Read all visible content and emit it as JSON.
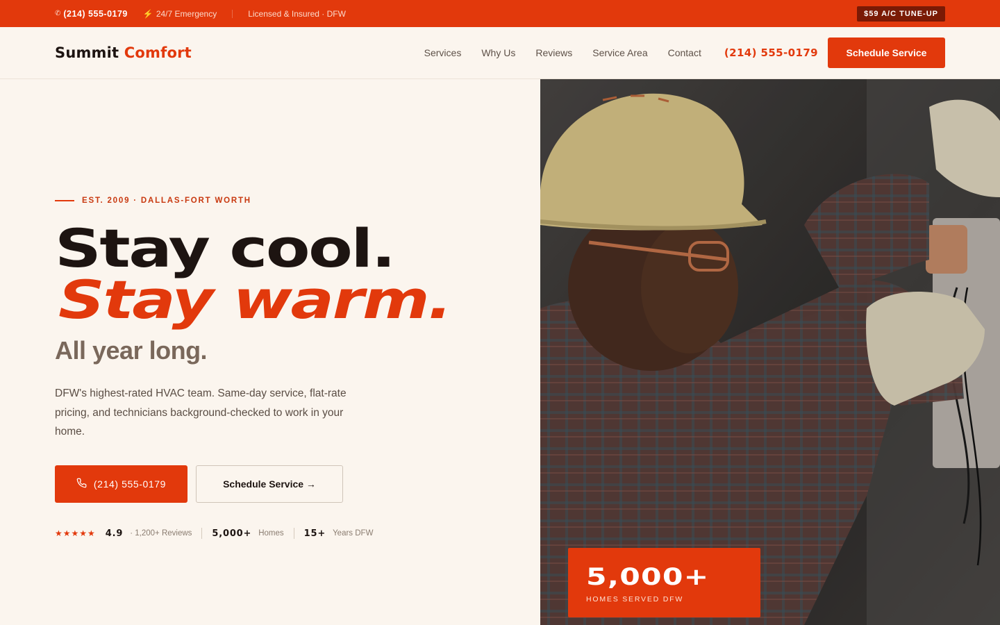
{
  "topbar": {
    "phone": "(214) 555-0179",
    "emergency": "24/7 Emergency",
    "licensed": "Licensed & Insured · DFW",
    "promo": "$59 A/C TUNE-UP"
  },
  "header": {
    "logo_part1": "Summit",
    "logo_part2": "Comfort",
    "nav": [
      "Services",
      "Why Us",
      "Reviews",
      "Service Area",
      "Contact"
    ],
    "phone": "(214) 555-0179",
    "cta": "Schedule Service"
  },
  "hero": {
    "eyebrow": "EST. 2009 · DALLAS-FORT WORTH",
    "headline1": "Stay cool.",
    "headline2": "Stay warm.",
    "headline3": "All year long.",
    "lead": "DFW's highest-rated HVAC team. Same-day service, flat-rate pricing, and technicians background-checked to work in your home.",
    "call_button": "(214) 555-0179",
    "schedule_button": "Schedule Service →",
    "stats": {
      "stars": "★★★★★",
      "rating": "4.9",
      "reviews": "· 1,200+ Reviews",
      "homes_num": "5,000+",
      "homes_lbl": "Homes",
      "years_num": "15+",
      "years_lbl": "Years DFW"
    }
  },
  "badge": {
    "number": "5,000+",
    "label": "HOMES SERVED DFW"
  },
  "colors": {
    "accent": "#e2390c",
    "background": "#fbf5ee",
    "text": "#1d1411"
  }
}
